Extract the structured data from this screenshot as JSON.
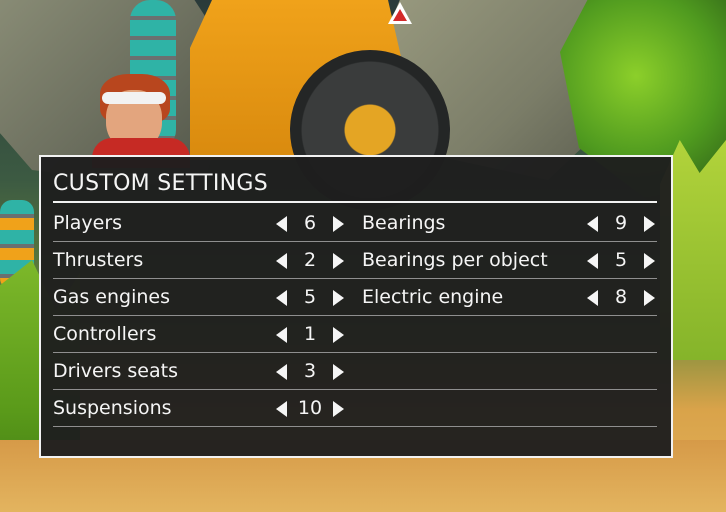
{
  "panel": {
    "title": "CUSTOM SETTINGS"
  },
  "settings_left": [
    {
      "label": "Players",
      "value": "6"
    },
    {
      "label": "Thrusters",
      "value": "2"
    },
    {
      "label": "Gas engines",
      "value": "5"
    },
    {
      "label": "Controllers",
      "value": "1"
    },
    {
      "label": "Drivers seats",
      "value": "3"
    },
    {
      "label": "Suspensions",
      "value": "10"
    }
  ],
  "settings_right": [
    {
      "label": "Bearings",
      "value": "9"
    },
    {
      "label": "Bearings per object",
      "value": "5"
    },
    {
      "label": "Electric engine",
      "value": "8"
    }
  ],
  "colors": {
    "panel_bg": "#1e1e1e",
    "panel_border": "#f2f2f2",
    "text": "#f5f5f5",
    "row_divider": "#8f8f8f"
  },
  "icons": {
    "decrement": "triangle-left-icon",
    "increment": "triangle-right-icon"
  }
}
